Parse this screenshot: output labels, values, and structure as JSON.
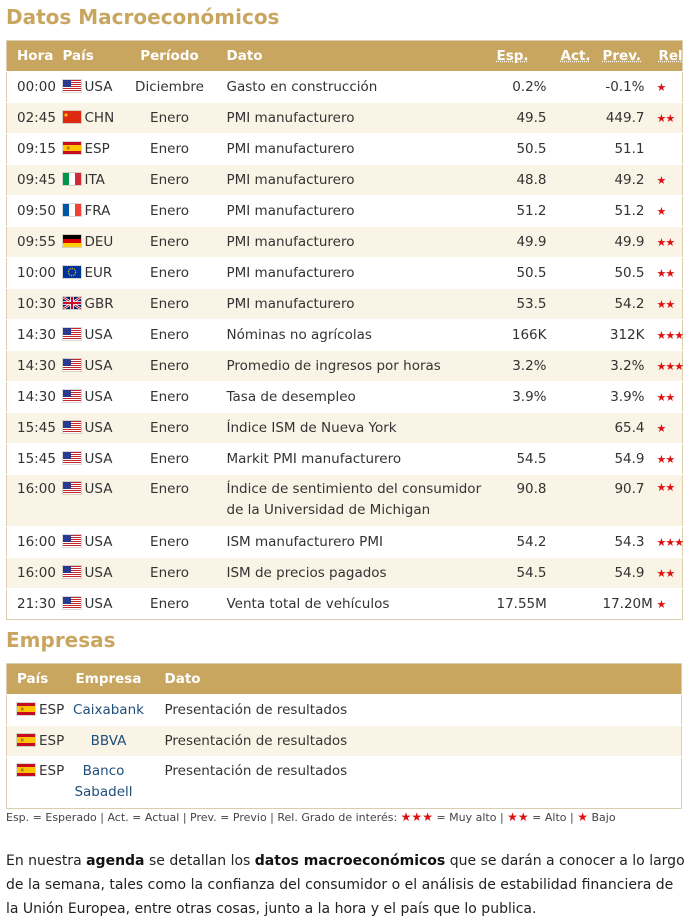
{
  "macro": {
    "title": "Datos Macroeconómicos",
    "headers": {
      "hora": "Hora",
      "pais": "País",
      "periodo": "Período",
      "dato": "Dato",
      "esp": "Esp.",
      "act": "Act.",
      "prev": "Prev.",
      "rel": "Rel."
    },
    "rows": [
      {
        "hora": "00:00",
        "flag": "usa",
        "pais": "USA",
        "periodo": "Diciembre",
        "dato": "Gasto en construcción",
        "esp": "0.2%",
        "act": "",
        "prev": "-0.1%",
        "rel": "★"
      },
      {
        "hora": "02:45",
        "flag": "chn",
        "pais": "CHN",
        "periodo": "Enero",
        "dato": "PMI manufacturero",
        "esp": "49.5",
        "act": "",
        "prev": "449.7",
        "rel": "★★"
      },
      {
        "hora": "09:15",
        "flag": "esp",
        "pais": "ESP",
        "periodo": "Enero",
        "dato": "PMI manufacturero",
        "esp": "50.5",
        "act": "",
        "prev": "51.1",
        "rel": ""
      },
      {
        "hora": "09:45",
        "flag": "ita",
        "pais": "ITA",
        "periodo": "Enero",
        "dato": "PMI manufacturero",
        "esp": "48.8",
        "act": "",
        "prev": "49.2",
        "rel": "★"
      },
      {
        "hora": "09:50",
        "flag": "fra",
        "pais": "FRA",
        "periodo": "Enero",
        "dato": "PMI manufacturero",
        "esp": "51.2",
        "act": "",
        "prev": "51.2",
        "rel": "★"
      },
      {
        "hora": "09:55",
        "flag": "deu",
        "pais": "DEU",
        "periodo": "Enero",
        "dato": "PMI manufacturero",
        "esp": "49.9",
        "act": "",
        "prev": "49.9",
        "rel": "★★"
      },
      {
        "hora": "10:00",
        "flag": "eur",
        "pais": "EUR",
        "periodo": "Enero",
        "dato": "PMI manufacturero",
        "esp": "50.5",
        "act": "",
        "prev": "50.5",
        "rel": "★★"
      },
      {
        "hora": "10:30",
        "flag": "gbr",
        "pais": "GBR",
        "periodo": "Enero",
        "dato": "PMI manufacturero",
        "esp": "53.5",
        "act": "",
        "prev": "54.2",
        "rel": "★★"
      },
      {
        "hora": "14:30",
        "flag": "usa",
        "pais": "USA",
        "periodo": "Enero",
        "dato": "Nóminas no agrícolas",
        "esp": "166K",
        "act": "",
        "prev": "312K",
        "rel": "★★★"
      },
      {
        "hora": "14:30",
        "flag": "usa",
        "pais": "USA",
        "periodo": "Enero",
        "dato": "Promedio de ingresos por horas",
        "esp": "3.2%",
        "act": "",
        "prev": "3.2%",
        "rel": "★★★"
      },
      {
        "hora": "14:30",
        "flag": "usa",
        "pais": "USA",
        "periodo": "Enero",
        "dato": "Tasa de desempleo",
        "esp": "3.9%",
        "act": "",
        "prev": "3.9%",
        "rel": "★★"
      },
      {
        "hora": "15:45",
        "flag": "usa",
        "pais": "USA",
        "periodo": "Enero",
        "dato": "Índice ISM de Nueva York",
        "esp": "",
        "act": "",
        "prev": "65.4",
        "rel": "★"
      },
      {
        "hora": "15:45",
        "flag": "usa",
        "pais": "USA",
        "periodo": "Enero",
        "dato": "Markit PMI manufacturero",
        "esp": "54.5",
        "act": "",
        "prev": "54.9",
        "rel": "★★"
      },
      {
        "hora": "16:00",
        "flag": "usa",
        "pais": "USA",
        "periodo": "Enero",
        "dato": "Índice de sentimiento del consumidor de la Universidad de Michigan",
        "esp": "90.8",
        "act": "",
        "prev": "90.7",
        "rel": "★★"
      },
      {
        "hora": "16:00",
        "flag": "usa",
        "pais": "USA",
        "periodo": "Enero",
        "dato": "ISM manufacturero PMI",
        "esp": "54.2",
        "act": "",
        "prev": "54.3",
        "rel": "★★★"
      },
      {
        "hora": "16:00",
        "flag": "usa",
        "pais": "USA",
        "periodo": "Enero",
        "dato": "ISM de precios pagados",
        "esp": "54.5",
        "act": "",
        "prev": "54.9",
        "rel": "★★"
      },
      {
        "hora": "21:30",
        "flag": "usa",
        "pais": "USA",
        "periodo": "Enero",
        "dato": "Venta total de vehículos",
        "esp": "17.55M",
        "act": "",
        "prev": "17.20M",
        "rel": "★"
      }
    ]
  },
  "empresas": {
    "title": "Empresas",
    "headers": {
      "pais": "País",
      "empresa": "Empresa",
      "dato": "Dato"
    },
    "rows": [
      {
        "flag": "esp",
        "pais": "ESP",
        "empresa": "Caixabank",
        "dato": "Presentación de resultados"
      },
      {
        "flag": "esp",
        "pais": "ESP",
        "empresa": "BBVA",
        "dato": "Presentación de resultados"
      },
      {
        "flag": "esp",
        "pais": "ESP",
        "empresa": "Banco Sabadell",
        "dato": "Presentación de resultados"
      }
    ]
  },
  "legend": {
    "text1": "Esp. = Esperado | Act. = Actual | Prev. = Previo | Rel. Grado de interés: ",
    "stars3": "★★★",
    "text2": " = Muy alto | ",
    "stars2": "★★",
    "text3": " = Alto | ",
    "stars1": "★",
    "text4": " Bajo"
  },
  "paragraph": {
    "p1": "En nuestra ",
    "b1": "agenda",
    "p2": " se detallan los ",
    "b2": "datos macroeconómicos",
    "p3": " que se darán a conocer a lo largo de la semana, tales como la confianza del consumidor o el análisis de estabilidad financiera de la Unión Europea, entre otras cosas, junto a la hora y el país que lo publica."
  },
  "colors": {
    "accent": "#c8a660",
    "row_alt": "#faf4e6",
    "star": "#dd1111",
    "link": "#1f4e79"
  }
}
